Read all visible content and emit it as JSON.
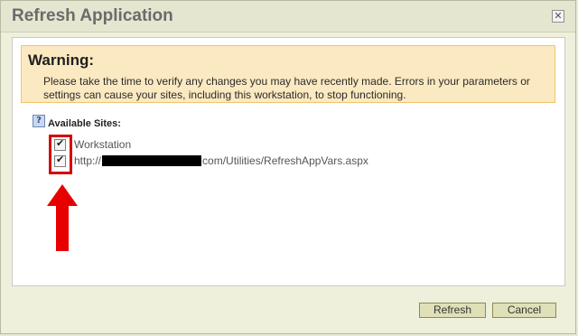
{
  "dialog": {
    "title": "Refresh Application",
    "close_symbol": "✕"
  },
  "warning": {
    "heading": "Warning:",
    "message": "Please take the time to verify any changes you may have recently made. Errors in your parameters or settings can cause your sites, including this workstation, to stop functioning."
  },
  "sites": {
    "help_icon_text": "?",
    "label": "Available Sites:",
    "items": [
      {
        "label": "Workstation",
        "checked": true
      },
      {
        "prefix": "http://",
        "suffix": "com/Utilities/RefreshAppVars.aspx",
        "checked": true
      }
    ]
  },
  "annotations": {
    "highlight_color": "#d40000",
    "arrow_icon": "up-arrow-icon"
  },
  "buttons": {
    "refresh": "Refresh",
    "cancel": "Cancel"
  }
}
